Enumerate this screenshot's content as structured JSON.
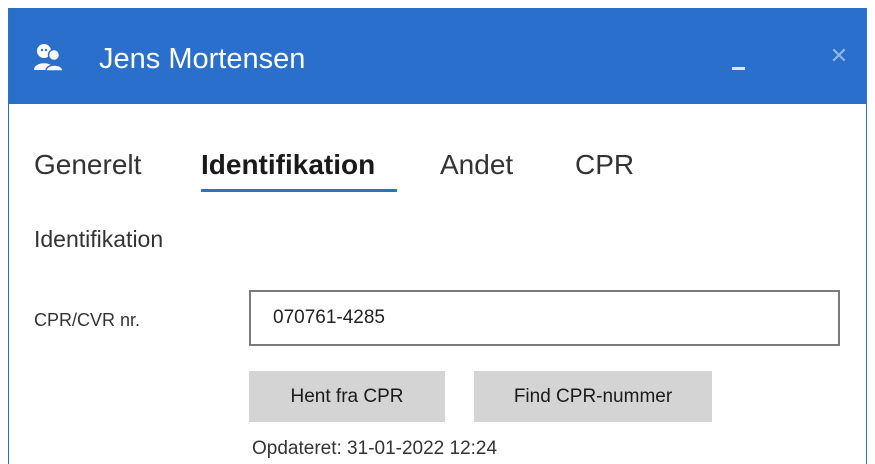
{
  "window": {
    "title": "Jens Mortensen",
    "icons": {
      "app": "users-icon",
      "minimize": "minimize-icon",
      "close": "close-icon"
    },
    "close_glyph": "✕"
  },
  "tabs": [
    {
      "label": "Generelt",
      "active": false
    },
    {
      "label": "Identifikation",
      "active": true
    },
    {
      "label": "Andet",
      "active": false
    },
    {
      "label": "CPR",
      "active": false
    }
  ],
  "section": {
    "title": "Identifikation"
  },
  "cpr_field": {
    "label": "CPR/CVR nr.",
    "value": "070761-4285"
  },
  "buttons": {
    "hent": "Hent fra CPR",
    "find": "Find CPR-nummer"
  },
  "status": {
    "updated": "Opdateret: 31-01-2022 12:24"
  },
  "colors": {
    "titlebar": "#2b6fcc",
    "accent": "#2b73c9",
    "button": "#d4d4d4"
  }
}
